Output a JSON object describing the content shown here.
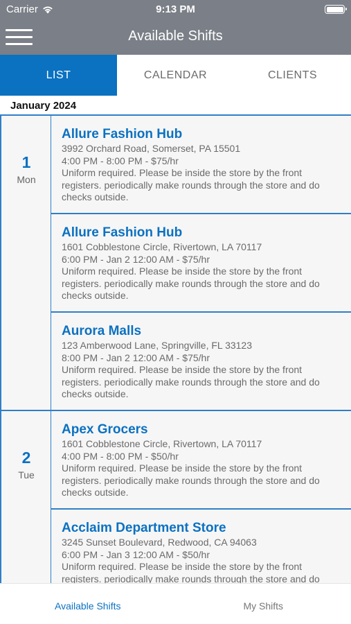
{
  "status": {
    "carrier": "Carrier",
    "time": "9:13 PM"
  },
  "header": {
    "title": "Available Shifts"
  },
  "tabs": [
    {
      "label": "LIST"
    },
    {
      "label": "CALENDAR"
    },
    {
      "label": "CLIENTS"
    }
  ],
  "month": "January 2024",
  "days": [
    {
      "num": "1",
      "name": "Mon",
      "shifts": [
        {
          "title": "Allure Fashion Hub",
          "address": "3992 Orchard Road, Somerset, PA 15501",
          "time": "4:00 PM - 8:00 PM - $75/hr",
          "desc": "Uniform required. Please be inside the store by the front registers. periodically make rounds through the store and do checks outside."
        },
        {
          "title": "Allure Fashion Hub",
          "address": "1601 Cobblestone Circle, Rivertown, LA 70117",
          "time": "6:00 PM - Jan 2 12:00 AM - $75/hr",
          "desc": "Uniform required. Please be inside the store by the front registers. periodically make rounds through the store and do checks outside."
        },
        {
          "title": "Aurora Malls",
          "address": "123 Amberwood Lane, Springville, FL 33123",
          "time": "8:00 PM - Jan 2 12:00 AM - $75/hr",
          "desc": "Uniform required. Please be inside the store by the front registers. periodically make rounds through the store and do checks outside."
        }
      ]
    },
    {
      "num": "2",
      "name": "Tue",
      "shifts": [
        {
          "title": "Apex Grocers",
          "address": "1601 Cobblestone Circle, Rivertown, LA 70117",
          "time": "4:00 PM - 8:00 PM - $50/hr",
          "desc": "Uniform required. Please be inside the store by the front registers. periodically make rounds through the store and do checks outside."
        },
        {
          "title": "Acclaim Department Store",
          "address": "3245 Sunset Boulevard, Redwood, CA 94063",
          "time": "6:00 PM - Jan 3 12:00 AM - $50/hr",
          "desc": "Uniform required. Please be inside the store by the front registers. periodically make rounds through the store and do checks outside."
        }
      ]
    }
  ],
  "bottom_tabs": [
    {
      "label": "Available Shifts"
    },
    {
      "label": "My Shifts"
    }
  ],
  "colors": {
    "accent": "#0b71c1",
    "header": "#7b7f87",
    "border": "#2f7fc7"
  }
}
